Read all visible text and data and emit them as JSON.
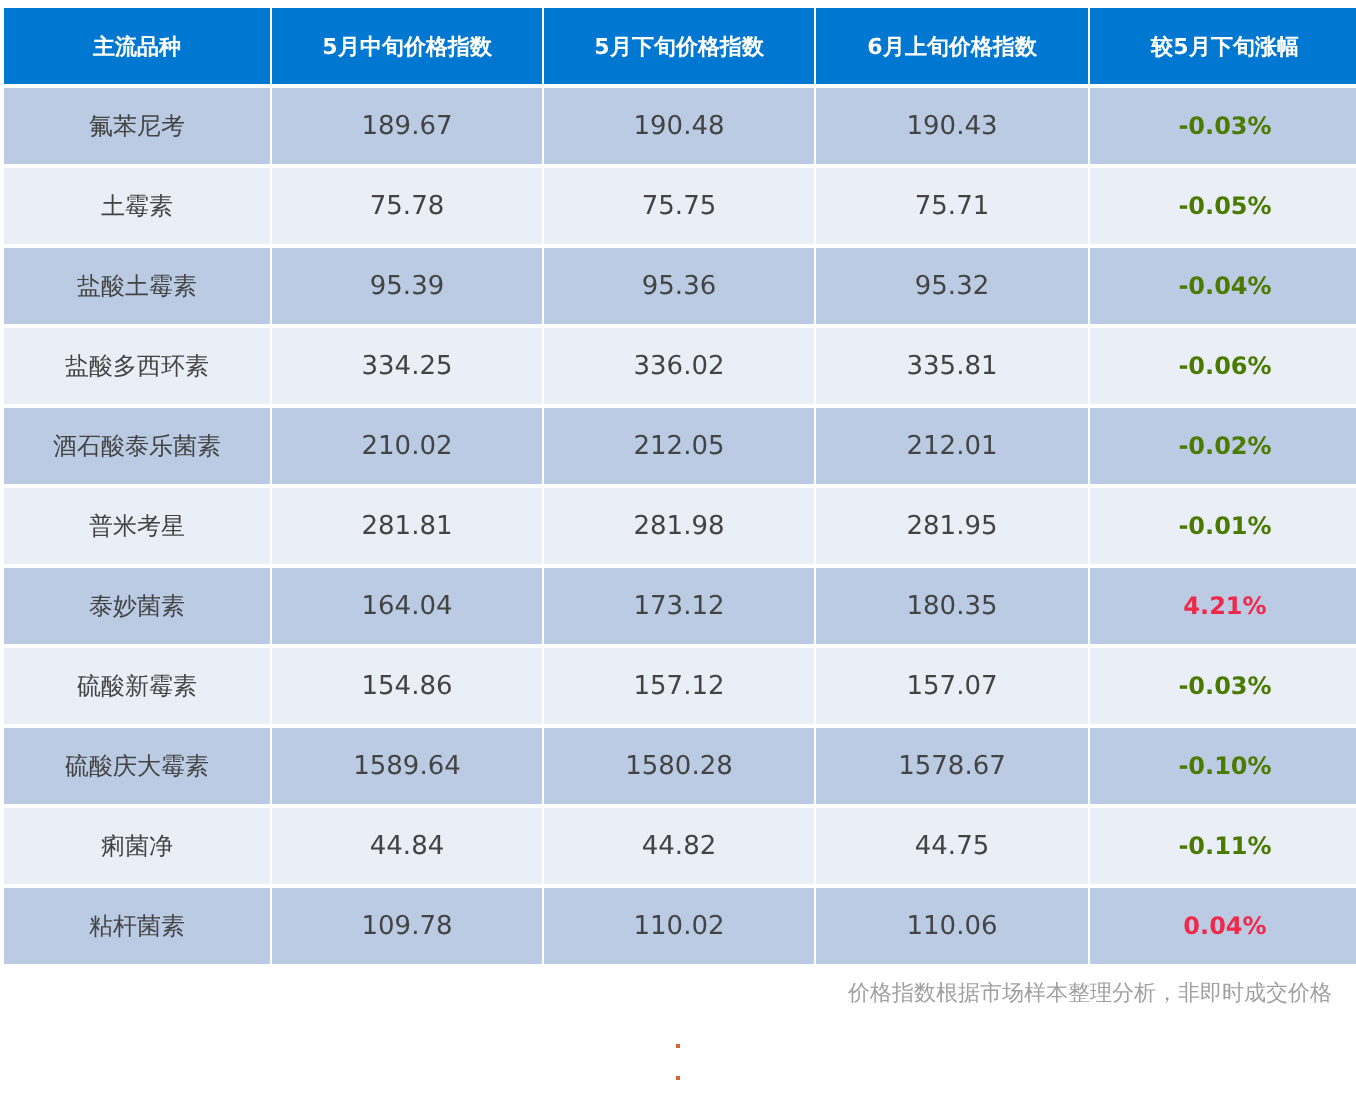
{
  "table": {
    "columns": [
      "主流品种",
      "5月中旬价格指数",
      "5月下旬价格指数",
      "6月上旬价格指数",
      "较5月下旬涨幅"
    ],
    "rows": [
      {
        "name": "氟苯尼考",
        "mid_may": "189.67",
        "late_may": "190.48",
        "early_june": "190.43",
        "change": "-0.03%",
        "color": "#4a7a00"
      },
      {
        "name": "土霉素",
        "mid_may": "75.78",
        "late_may": "75.75",
        "early_june": "75.71",
        "change": "-0.05%",
        "color": "#4a7a00"
      },
      {
        "name": "盐酸土霉素",
        "mid_may": "95.39",
        "late_may": "95.36",
        "early_june": "95.32",
        "change": "-0.04%",
        "color": "#4a7a00"
      },
      {
        "name": "盐酸多西环素",
        "mid_may": "334.25",
        "late_may": "336.02",
        "early_june": "335.81",
        "change": "-0.06%",
        "color": "#4a7a00"
      },
      {
        "name": "酒石酸泰乐菌素",
        "mid_may": "210.02",
        "late_may": "212.05",
        "early_june": "212.01",
        "change": "-0.02%",
        "color": "#4a7a00"
      },
      {
        "name": "普米考星",
        "mid_may": "281.81",
        "late_may": "281.98",
        "early_june": "281.95",
        "change": "-0.01%",
        "color": "#4a7a00"
      },
      {
        "name": "泰妙菌素",
        "mid_may": "164.04",
        "late_may": "173.12",
        "early_june": "180.35",
        "change": "4.21%",
        "color": "#f0284a"
      },
      {
        "name": "硫酸新霉素",
        "mid_may": "154.86",
        "late_may": "157.12",
        "early_june": "157.07",
        "change": "-0.03%",
        "color": "#4a7a00"
      },
      {
        "name": "硫酸庆大霉素",
        "mid_may": "1589.64",
        "late_may": "1580.28",
        "early_june": "1578.67",
        "change": "-0.10%",
        "color": "#4a7a00"
      },
      {
        "name": "痢菌净",
        "mid_may": "44.84",
        "late_may": "44.82",
        "early_june": "44.75",
        "change": "-0.11%",
        "color": "#4a7a00"
      },
      {
        "name": "粘杆菌素",
        "mid_may": "109.78",
        "late_may": "110.02",
        "early_june": "110.06",
        "change": "0.04%",
        "color": "#f0284a"
      }
    ]
  },
  "footnote": "价格指数根据市场样本整理分析，非即时成交价格"
}
